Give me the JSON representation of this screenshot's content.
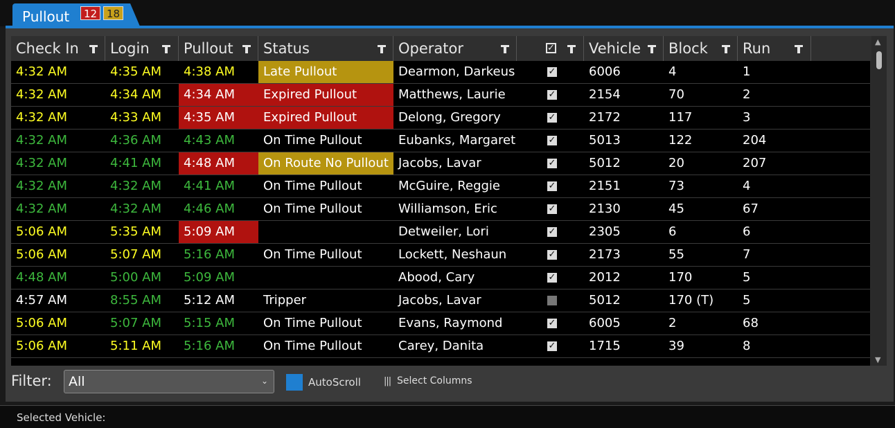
{
  "tab": {
    "label": "Pullout",
    "badge_red": "12",
    "badge_gold": "18"
  },
  "columns": [
    "Check In",
    "Login",
    "Pullout",
    "Status",
    "Operator",
    "",
    "Vehicle",
    "Block",
    "Run"
  ],
  "rows": [
    {
      "checkin": "4:32 AM",
      "login": "4:35 AM",
      "pullout": "4:38 AM",
      "status": "Late Pullout",
      "operator": "Dearmon, Darkeus",
      "checked": true,
      "vehicle": "6006",
      "block": "4",
      "run": "1"
    },
    {
      "checkin": "4:32 AM",
      "login": "4:34 AM",
      "pullout": "4:34 AM",
      "status": "Expired Pullout",
      "operator": "Matthews, Laurie",
      "checked": true,
      "vehicle": "2154",
      "block": "70",
      "run": "2"
    },
    {
      "checkin": "4:32 AM",
      "login": "4:33 AM",
      "pullout": "4:35 AM",
      "status": "Expired Pullout",
      "operator": "Delong, Gregory",
      "checked": true,
      "vehicle": "2172",
      "block": "117",
      "run": "3"
    },
    {
      "checkin": "4:32 AM",
      "login": "4:36 AM",
      "pullout": "4:43 AM",
      "status": "On Time Pullout",
      "operator": "Eubanks, Margaret",
      "checked": true,
      "vehicle": "5013",
      "block": "122",
      "run": "204"
    },
    {
      "checkin": "4:32 AM",
      "login": "4:41 AM",
      "pullout": "4:48 AM",
      "status": "On Route No Pullout",
      "operator": "Jacobs, Lavar",
      "checked": true,
      "vehicle": "5012",
      "block": "20",
      "run": "207"
    },
    {
      "checkin": "4:32 AM",
      "login": "4:32 AM",
      "pullout": "4:41 AM",
      "status": "On Time Pullout",
      "operator": "McGuire, Reggie",
      "checked": true,
      "vehicle": "2151",
      "block": "73",
      "run": "4"
    },
    {
      "checkin": "4:32 AM",
      "login": "4:32 AM",
      "pullout": "4:46 AM",
      "status": "On Time Pullout",
      "operator": "Williamson, Eric",
      "checked": true,
      "vehicle": "2130",
      "block": "45",
      "run": "67"
    },
    {
      "checkin": "5:06 AM",
      "login": "5:35 AM",
      "pullout": "5:09 AM",
      "status": "",
      "operator": "Detweiler, Lori",
      "checked": true,
      "vehicle": "2305",
      "block": "6",
      "run": "6"
    },
    {
      "checkin": "5:06 AM",
      "login": "5:07 AM",
      "pullout": "5:16 AM",
      "status": "On Time Pullout",
      "operator": "Lockett, Neshaun",
      "checked": true,
      "vehicle": "2173",
      "block": "55",
      "run": "7"
    },
    {
      "checkin": "4:48 AM",
      "login": "5:00 AM",
      "pullout": "5:09 AM",
      "status": "",
      "operator": "Abood, Cary",
      "checked": true,
      "vehicle": "2012",
      "block": "170",
      "run": "5"
    },
    {
      "checkin": "4:57 AM",
      "login": "8:55 AM",
      "pullout": "5:12 AM",
      "status": "Tripper",
      "operator": "Jacobs, Lavar",
      "checked": false,
      "vehicle": "5012",
      "block": "170 (T)",
      "run": "5"
    },
    {
      "checkin": "5:06 AM",
      "login": "5:07 AM",
      "pullout": "5:15 AM",
      "status": "On Time Pullout",
      "operator": "Evans, Raymond",
      "checked": true,
      "vehicle": "6005",
      "block": "2",
      "run": "68"
    },
    {
      "checkin": "5:06 AM",
      "login": "5:11 AM",
      "pullout": "5:16 AM",
      "status": "On Time Pullout",
      "operator": "Carey, Danita",
      "checked": true,
      "vehicle": "1715",
      "block": "39",
      "run": "8"
    }
  ],
  "row_styles": [
    {
      "checkin": "yellow",
      "login": "yellow",
      "pullout": "yellow",
      "status_bg": "gold"
    },
    {
      "checkin": "yellow",
      "login": "yellow",
      "pullout": "white-red",
      "status_bg": "red"
    },
    {
      "checkin": "yellow",
      "login": "yellow",
      "pullout": "white-red",
      "status_bg": "red"
    },
    {
      "checkin": "green",
      "login": "green",
      "pullout": "green",
      "status_bg": "none"
    },
    {
      "checkin": "green",
      "login": "green",
      "pullout": "white-red",
      "status_bg": "gold"
    },
    {
      "checkin": "green",
      "login": "green",
      "pullout": "green",
      "status_bg": "none"
    },
    {
      "checkin": "green",
      "login": "green",
      "pullout": "green",
      "status_bg": "none"
    },
    {
      "checkin": "yellow",
      "login": "yellow",
      "pullout": "white-red",
      "status_bg": "none"
    },
    {
      "checkin": "yellow",
      "login": "yellow",
      "pullout": "green",
      "status_bg": "none"
    },
    {
      "checkin": "green",
      "login": "green",
      "pullout": "green",
      "status_bg": "none"
    },
    {
      "checkin": "white",
      "login": "green",
      "pullout": "white",
      "status_bg": "none"
    },
    {
      "checkin": "yellow",
      "login": "green",
      "pullout": "green",
      "status_bg": "none"
    },
    {
      "checkin": "yellow",
      "login": "yellow",
      "pullout": "green",
      "status_bg": "none"
    }
  ],
  "filter": {
    "label": "Filter:",
    "value": "All"
  },
  "autoscroll_label": "AutoScroll",
  "select_columns_label": "Select Columns",
  "selected_vehicle_label": "Selected Vehicle:",
  "colors": {
    "accent": "#1f7fd0",
    "yellow": "#ffff22",
    "green": "#3db83d",
    "red": "#b0120f",
    "gold": "#b69410"
  }
}
